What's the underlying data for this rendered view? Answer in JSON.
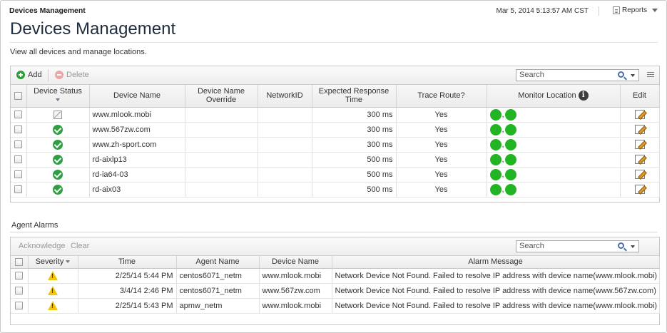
{
  "header": {
    "breadcrumb": "Devices Management",
    "datetime": "Mar 5, 2014 5:13:57 AM CST",
    "reports_label": "Reports",
    "title": "Devices Management",
    "subtitle": "View all devices and manage locations."
  },
  "devices": {
    "toolbar": {
      "add_label": "Add",
      "delete_label": "Delete",
      "search_placeholder": "Search"
    },
    "columns": {
      "status": "Device Status",
      "name": "Device Name",
      "override": "Device Name Override",
      "network_id": "NetworkID",
      "expected": "Expected Response Time",
      "trace": "Trace Route?",
      "monitor": "Monitor Location",
      "edit": "Edit"
    },
    "rows": [
      {
        "status": "unknown",
        "name": "www.mlook.mobi",
        "override": "",
        "network_id": "",
        "expected": "300 ms",
        "trace": "Yes"
      },
      {
        "status": "ok",
        "name": "www.567zw.com",
        "override": "",
        "network_id": "",
        "expected": "300 ms",
        "trace": "Yes"
      },
      {
        "status": "ok",
        "name": "www.zh-sport.com",
        "override": "",
        "network_id": "",
        "expected": "300 ms",
        "trace": "Yes"
      },
      {
        "status": "ok",
        "name": "rd-aixlp13",
        "override": "",
        "network_id": "",
        "expected": "500 ms",
        "trace": "Yes"
      },
      {
        "status": "ok",
        "name": "rd-ia64-03",
        "override": "",
        "network_id": "",
        "expected": "500 ms",
        "trace": "Yes"
      },
      {
        "status": "ok",
        "name": "rd-aix03",
        "override": "",
        "network_id": "",
        "expected": "500 ms",
        "trace": "Yes"
      }
    ],
    "monitor_separator": ",",
    "location_dot_color": "#22b422"
  },
  "alarms": {
    "section_title": "Agent Alarms",
    "toolbar": {
      "acknowledge_label": "Acknowledge",
      "clear_label": "Clear",
      "search_placeholder": "Search"
    },
    "columns": {
      "severity": "Severity",
      "time": "Time",
      "agent": "Agent Name",
      "device": "Device Name",
      "message": "Alarm Message"
    },
    "rows": [
      {
        "time": "2/25/14 5:44 PM",
        "agent": "centos6071_netm",
        "device": "www.mlook.mobi",
        "message": "Network Device Not Found. Failed to resolve IP address with device name(www.mlook.mobi)"
      },
      {
        "time": "3/4/14 2:46 PM",
        "agent": "centos6071_netm",
        "device": "www.567zw.com",
        "message": "Network Device Not Found. Failed to resolve IP address with device name(www.567zw.com)"
      },
      {
        "time": "2/25/14 5:43 PM",
        "agent": "apmw_netm",
        "device": "www.mlook.mobi",
        "message": "Network Device Not Found. Failed to resolve IP address with device name(www.mlook.mobi)"
      }
    ]
  }
}
